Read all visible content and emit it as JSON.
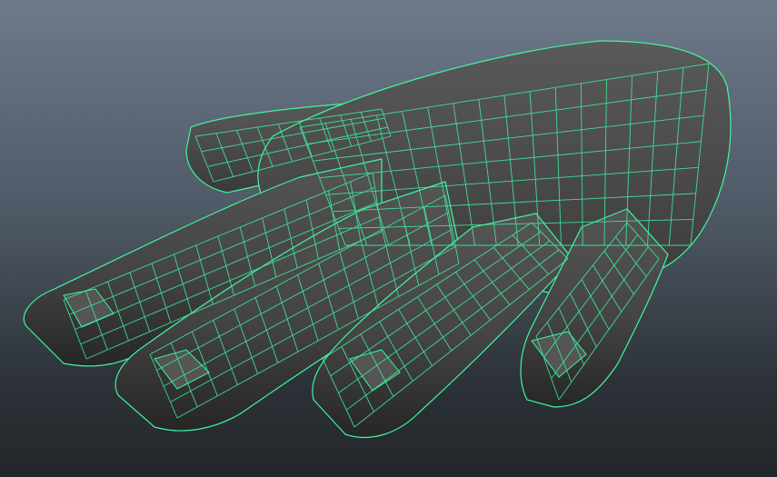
{
  "viewport": {
    "background_top": "#6d7a89",
    "background_bottom": "#23272b"
  },
  "model": {
    "wire_color": "#3ef5a0",
    "surface_light": "#5c5c5c",
    "surface_mid": "#4a4a4a",
    "surface_dark": "#2b2b2b",
    "nail_color": "#555555"
  }
}
